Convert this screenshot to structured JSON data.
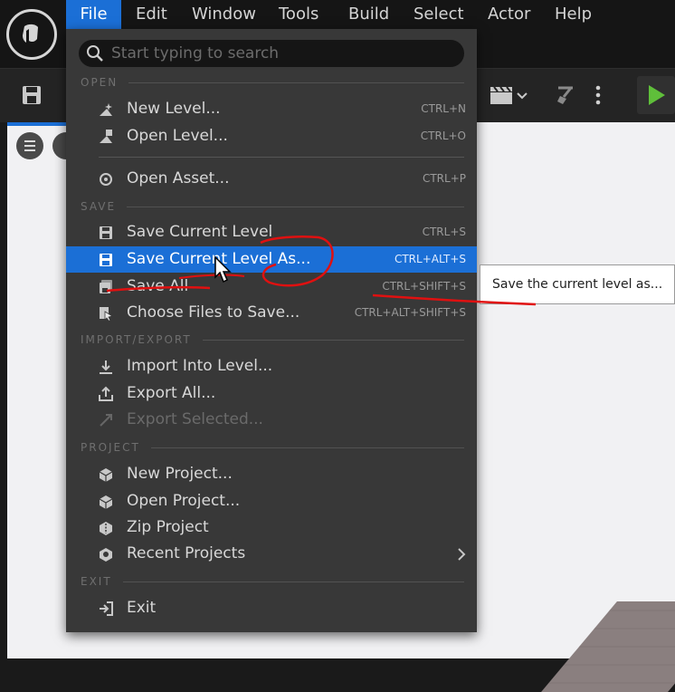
{
  "menubar": {
    "items": [
      "File",
      "Edit",
      "Window",
      "Tools",
      "Build",
      "Select",
      "Actor",
      "Help"
    ],
    "active": "File"
  },
  "file_menu": {
    "search_placeholder": "Start typing to search",
    "sections": {
      "open": "OPEN",
      "save": "SAVE",
      "import_export": "IMPORT/EXPORT",
      "project": "PROJECT",
      "exit": "EXIT"
    },
    "items": [
      {
        "label": "New Level...",
        "shortcut": "CTRL+N",
        "icon": "new-level-icon"
      },
      {
        "label": "Open Level...",
        "shortcut": "CTRL+O",
        "icon": "open-level-icon"
      },
      {
        "label": "Open Asset...",
        "shortcut": "CTRL+P",
        "icon": "open-asset-icon"
      },
      {
        "label": "Save Current Level",
        "shortcut": "CTRL+S",
        "icon": "save-icon"
      },
      {
        "label": "Save Current Level As...",
        "shortcut": "CTRL+ALT+S",
        "icon": "save-as-icon"
      },
      {
        "label": "Save All",
        "shortcut": "CTRL+SHIFT+S",
        "icon": "save-all-icon"
      },
      {
        "label": "Choose Files to Save...",
        "shortcut": "CTRL+ALT+SHIFT+S",
        "icon": "choose-files-icon"
      },
      {
        "label": "Import Into Level...",
        "shortcut": "",
        "icon": "import-icon"
      },
      {
        "label": "Export All...",
        "shortcut": "",
        "icon": "export-icon"
      },
      {
        "label": "Export Selected...",
        "shortcut": "",
        "icon": "export-selected-icon"
      },
      {
        "label": "New Project...",
        "shortcut": "",
        "icon": "new-project-icon"
      },
      {
        "label": "Open Project...",
        "shortcut": "",
        "icon": "open-project-icon"
      },
      {
        "label": "Zip Project",
        "shortcut": "",
        "icon": "zip-project-icon"
      },
      {
        "label": "Recent Projects",
        "shortcut": "",
        "icon": "recent-projects-icon"
      },
      {
        "label": "Exit",
        "shortcut": "",
        "icon": "exit-icon"
      }
    ]
  },
  "tooltip": {
    "text": "Save the current level as..."
  },
  "colors": {
    "accent": "#1b6fd6",
    "menu_bg": "#383838",
    "annotation": "#e01010",
    "play": "#5fbf3a"
  }
}
